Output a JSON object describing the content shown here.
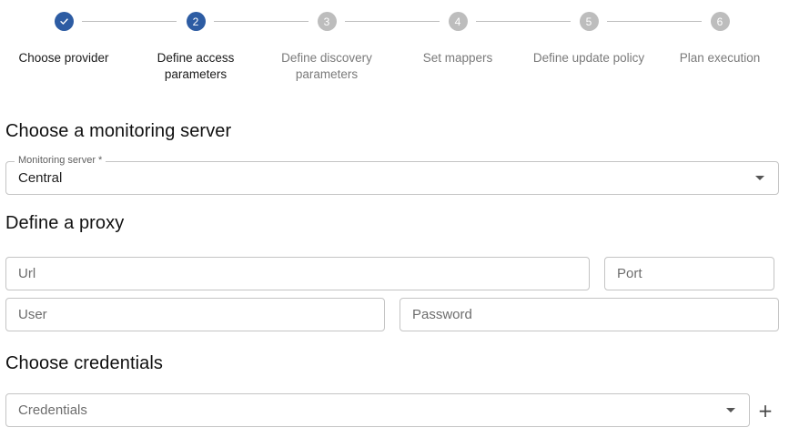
{
  "stepper": {
    "steps": [
      {
        "number": "✓",
        "label": "Choose provider",
        "state": "done"
      },
      {
        "number": "2",
        "label": "Define access parameters",
        "state": "active"
      },
      {
        "number": "3",
        "label": "Define discovery parameters",
        "state": "pending"
      },
      {
        "number": "4",
        "label": "Set mappers",
        "state": "pending"
      },
      {
        "number": "5",
        "label": "Define update policy",
        "state": "pending"
      },
      {
        "number": "6",
        "label": "Plan execution",
        "state": "pending"
      }
    ]
  },
  "monitoring": {
    "title": "Choose a monitoring server",
    "field_label": "Monitoring server *",
    "value": "Central"
  },
  "proxy": {
    "title": "Define a proxy",
    "url_placeholder": "Url",
    "port_placeholder": "Port",
    "user_placeholder": "User",
    "password_placeholder": "Password"
  },
  "credentials": {
    "title": "Choose credentials",
    "placeholder": "Credentials",
    "add_label": "+"
  },
  "colors": {
    "accent": "#2d5ca3",
    "pending": "#bdbdbd"
  }
}
